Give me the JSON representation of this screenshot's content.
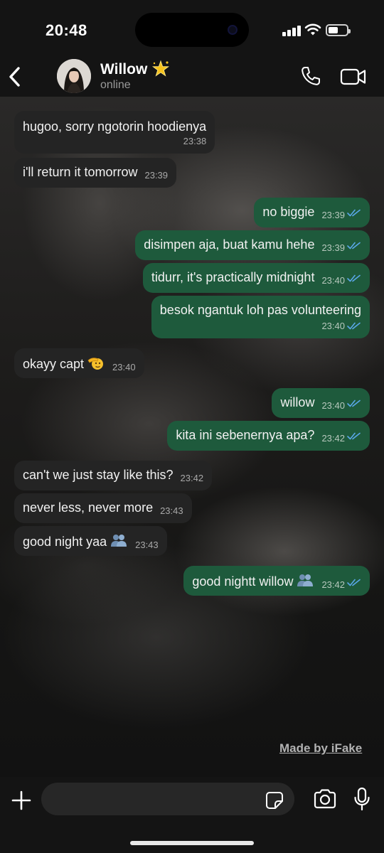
{
  "status_bar": {
    "time": "20:48",
    "battery_level": 0.55
  },
  "header": {
    "back_icon": "chevron-left-icon",
    "contact_name": "Willow",
    "contact_status": "online",
    "call_icon": "phone-icon",
    "video_icon": "video-camera-icon"
  },
  "messages": [
    {
      "direction": "in",
      "text": "hugoo, sorry ngotorin hoodienya",
      "time": "23:38"
    },
    {
      "direction": "in",
      "text": "i'll return it tomorrow",
      "time": "23:39"
    },
    {
      "direction": "out",
      "text": "no biggie",
      "time": "23:39",
      "status": "read"
    },
    {
      "direction": "out",
      "text": "disimpen aja, buat kamu hehe",
      "time": "23:39",
      "status": "read"
    },
    {
      "direction": "out",
      "text": "tidurr, it's practically midnight",
      "time": "23:40",
      "status": "read"
    },
    {
      "direction": "out",
      "text": "besok ngantuk loh pas volunteering",
      "time": "23:40",
      "status": "read"
    },
    {
      "direction": "in",
      "text": "okayy capt",
      "emoji": "saluting-face-icon",
      "time": "23:40"
    },
    {
      "direction": "out",
      "text": "willow",
      "time": "23:40",
      "status": "read"
    },
    {
      "direction": "out",
      "text": "kita ini sebenernya apa?",
      "time": "23:42",
      "status": "read"
    },
    {
      "direction": "in",
      "text": "can't we just stay like this?",
      "time": "23:42"
    },
    {
      "direction": "in",
      "text": "never less, never more",
      "time": "23:43"
    },
    {
      "direction": "in",
      "text": "good night yaa",
      "emoji": "busts-in-silhouette-icon",
      "time": "23:43"
    },
    {
      "direction": "out",
      "text": "good nightt willow",
      "emoji": "busts-in-silhouette-icon",
      "time": "23:42",
      "status": "read"
    }
  ],
  "watermark": "Made by iFake",
  "input_bar": {
    "plus_icon": "plus-icon",
    "placeholder": "",
    "sticker_icon": "sticker-icon",
    "camera_icon": "camera-icon",
    "mic_icon": "microphone-icon"
  },
  "colors": {
    "incoming_bubble": "#242424",
    "outgoing_bubble": "#1e5a3c",
    "read_ticks": "#5aa7e8",
    "bars": "#141414"
  }
}
